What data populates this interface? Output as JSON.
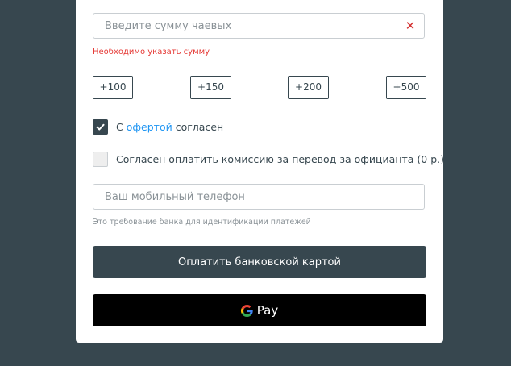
{
  "tip_input": {
    "placeholder": "Введите сумму чаевых",
    "value": "",
    "clear_icon": "close-icon",
    "clear_color": "#d32f2f"
  },
  "error_text": "Необходимо указать сумму",
  "amount_buttons": [
    "+100",
    "+150",
    "+200",
    "+500"
  ],
  "offer_checkbox": {
    "checked": true,
    "prefix": "С",
    "link": "офертой",
    "suffix": "согласен"
  },
  "commission_checkbox": {
    "checked": false,
    "label": "Согласен оплатить комиссию за перевод за официанта (0 р.)"
  },
  "phone_input": {
    "placeholder": "Ваш мобильный телефон",
    "value": ""
  },
  "phone_hint": "Это требование банка для идентификации платежей",
  "pay_card_button": "Оплатить банковской картой",
  "gpay_button": {
    "icon": "google-g-icon",
    "label": "Pay"
  },
  "colors": {
    "background": "#37474f",
    "accent": "#2196f3",
    "error": "#e53935",
    "button_dark": "#37474f",
    "gpay": "#000000"
  }
}
